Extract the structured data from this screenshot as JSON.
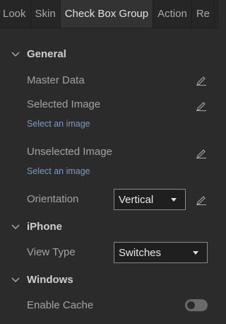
{
  "tabs": [
    {
      "label": "Look",
      "active": false
    },
    {
      "label": "Skin",
      "active": false
    },
    {
      "label": "Check Box Group",
      "active": true
    },
    {
      "label": "Action",
      "active": false
    },
    {
      "label": "Re",
      "active": false
    }
  ],
  "sections": {
    "general": {
      "title": "General",
      "master_data": {
        "label": "Master Data",
        "icon": "pencil-icon"
      },
      "selected_image": {
        "label": "Selected Image",
        "link": "Select an image",
        "icon": "pencil-icon"
      },
      "unselected_image": {
        "label": "Unselected Image",
        "link": "Select an image",
        "icon": "pencil-icon"
      },
      "orientation": {
        "label": "Orientation",
        "value": "Vertical",
        "icon": "pencil-icon"
      }
    },
    "iphone": {
      "title": "iPhone",
      "view_type": {
        "label": "View Type",
        "value": "Switches"
      }
    },
    "windows": {
      "title": "Windows",
      "enable_cache": {
        "label": "Enable Cache",
        "enabled": false
      }
    }
  },
  "colors": {
    "background": "#2b2b2b",
    "link": "#7a9bc0",
    "active_tab": "#333333"
  }
}
